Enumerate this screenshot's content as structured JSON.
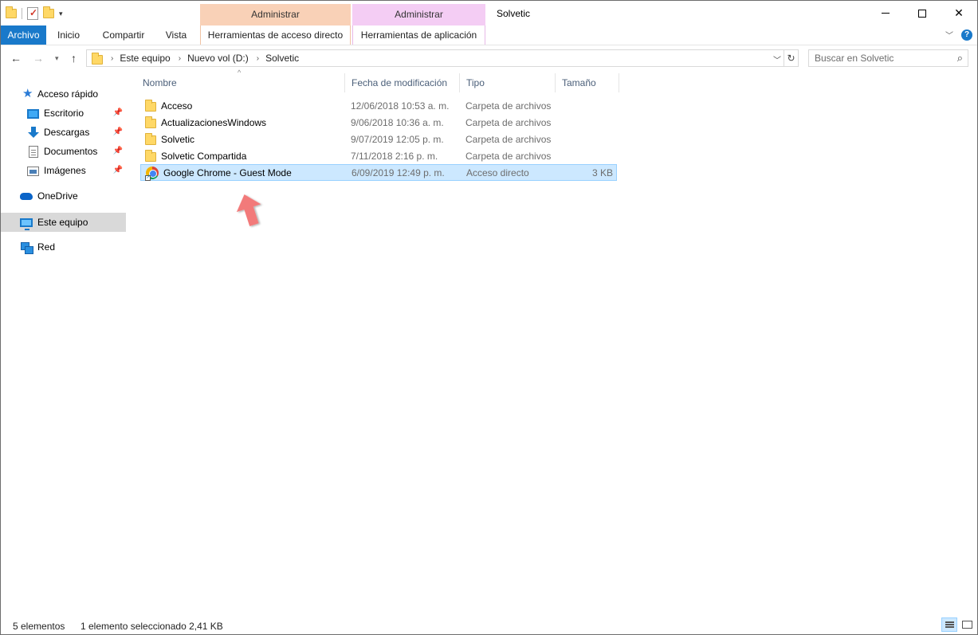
{
  "window": {
    "title": "Solvetic",
    "context_tab_1_header": "Administrar",
    "context_tab_2_header": "Administrar"
  },
  "ribbon": {
    "tabs": [
      {
        "label": "Archivo"
      },
      {
        "label": "Inicio"
      },
      {
        "label": "Compartir"
      },
      {
        "label": "Vista"
      },
      {
        "label": "Herramientas de acceso directo"
      },
      {
        "label": "Herramientas de aplicación"
      }
    ]
  },
  "address": {
    "breadcrumbs": [
      "Este equipo",
      "Nuevo vol (D:)",
      "Solvetic"
    ]
  },
  "search": {
    "placeholder": "Buscar en Solvetic"
  },
  "nav_pane": {
    "quick_access": "Acceso rápido",
    "items": [
      {
        "label": "Escritorio",
        "pinned": true
      },
      {
        "label": "Descargas",
        "pinned": true
      },
      {
        "label": "Documentos",
        "pinned": true
      },
      {
        "label": "Imágenes",
        "pinned": true
      }
    ],
    "onedrive": "OneDrive",
    "this_pc": "Este equipo",
    "network": "Red"
  },
  "file_list": {
    "columns": [
      "Nombre",
      "Fecha de modificación",
      "Tipo",
      "Tamaño"
    ],
    "rows": [
      {
        "name": "Acceso",
        "date": "12/06/2018 10:53 a. m.",
        "type": "Carpeta de archivos",
        "size": ""
      },
      {
        "name": "ActualizacionesWindows",
        "date": "9/06/2018 10:36 a. m.",
        "type": "Carpeta de archivos",
        "size": ""
      },
      {
        "name": "Solvetic",
        "date": "9/07/2019 12:05 p. m.",
        "type": "Carpeta de archivos",
        "size": ""
      },
      {
        "name": "Solvetic Compartida",
        "date": "7/11/2018 2:16 p. m.",
        "type": "Carpeta de archivos",
        "size": ""
      },
      {
        "name": "Google Chrome - Guest Mode",
        "date": "6/09/2019 12:49 p. m.",
        "type": "Acceso directo",
        "size": "3 KB",
        "selected": true
      }
    ]
  },
  "status": {
    "item_count": "5 elementos",
    "selection": "1 elemento seleccionado  2,41 KB"
  },
  "colors": {
    "accent": "#1979ca",
    "selection": "#cce8ff",
    "context_orange": "#f9d1b7",
    "context_pink": "#f4cdf4",
    "annotation_arrow": "#f27a7a"
  }
}
